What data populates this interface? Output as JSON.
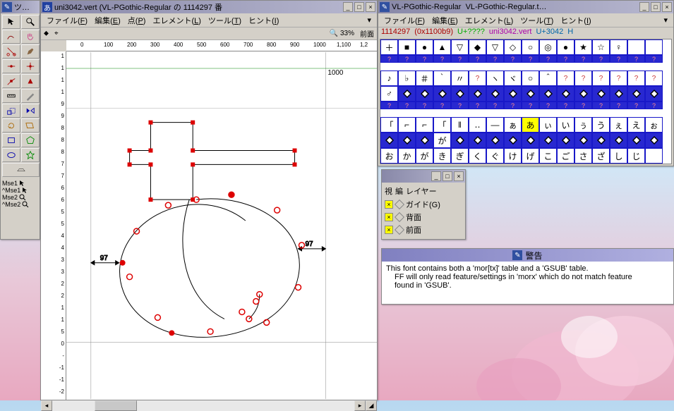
{
  "tool_window": {
    "title": "ツ…"
  },
  "glyph_window": {
    "icon": "あ",
    "title": "uni3042.vert (VL-PGothic-Regular の 1114297 番",
    "menus": [
      "ファイル(F)",
      "編集(E)",
      "点(P)",
      "エレメント(L)",
      "ツール(T)",
      "ヒント(I)"
    ],
    "info": {
      "zoom": "33%",
      "layer": "前面"
    },
    "ruler_h": [
      "0",
      "100",
      "200",
      "300",
      "400",
      "500",
      "600",
      "700",
      "800",
      "900",
      "1000",
      "1,100",
      "1,2"
    ],
    "ruler_v": [
      "1",
      "1",
      "1",
      "1",
      "9",
      "9",
      "8",
      "8",
      "8",
      "7",
      "7",
      "6",
      "6",
      "5",
      "5",
      "4",
      "4",
      "3",
      "3",
      "2",
      "2",
      "1",
      "1",
      "5",
      "0",
      "-",
      "-1",
      "-1",
      "-2"
    ],
    "adv_label_left": "97",
    "adv_label_right": "97",
    "em_label": "1000"
  },
  "font_window": {
    "title_left": "VL-PGothic-Regular",
    "title_right": "VL-PGothic-Regular.t…",
    "menus": [
      "ファイル(F)",
      "編集(E)",
      "エレメント(L)",
      "ツール(T)",
      "ヒント(I)"
    ],
    "info": {
      "cid": "1114297",
      "hex": "(0x1100b9)",
      "uq": "U+????",
      "name": "uni3042.vert",
      "u": "U+3042",
      "rest": "H"
    },
    "rows": [
      [
        "＋",
        "■",
        "●",
        "▲",
        "▽",
        "◆",
        "▽",
        "◇",
        "○",
        "◎",
        "●",
        "★",
        "☆",
        "♀"
      ],
      [
        "?",
        "?",
        "?",
        "?",
        "?",
        "?",
        "?",
        "?",
        "?",
        "?",
        "?",
        "?",
        "?",
        "?",
        "?",
        "?"
      ],
      [
        "♪",
        "♭",
        "＃",
        "｀",
        "〃",
        "?",
        "ヽ",
        "ヾ",
        "○",
        "＾",
        "?",
        "?",
        "?",
        "?",
        "?",
        "?"
      ],
      [
        "♂",
        "◈",
        "◈",
        "◈",
        "◈",
        "◈",
        "◈",
        "◈",
        "◈",
        "◈",
        "◈",
        "◈",
        "◈",
        "◈",
        "◈",
        "◈"
      ],
      [
        "?",
        "?",
        "?",
        "?",
        "?",
        "?",
        "?",
        "?",
        "?",
        "?",
        "?",
        "?",
        "?",
        "?",
        "?",
        "?"
      ],
      [
        "「",
        "⌐",
        "⌐",
        "「",
        "‖",
        "‥",
        "―",
        "ぁ",
        "あ",
        "ぃ",
        "い",
        "ぅ",
        "う",
        "ぇ",
        "え",
        "ぉ"
      ],
      [
        "◈",
        "◈",
        "◈",
        "が",
        "◈",
        "◈",
        "◈",
        "◈",
        "◈",
        "◈",
        "◈",
        "◈",
        "◈",
        "◈",
        "◈",
        "◈"
      ],
      [
        "お",
        "か",
        "が",
        "き",
        "ぎ",
        "く",
        "ぐ",
        "け",
        "げ",
        "こ",
        "ご",
        "さ",
        "ざ",
        "し",
        "じ"
      ]
    ],
    "selected": [
      5,
      8
    ]
  },
  "layers_window": {
    "hdr": [
      "視",
      "編",
      "レイヤー"
    ],
    "rows": [
      {
        "chk1": true,
        "chk2": false,
        "label": "ガイド(G)"
      },
      {
        "chk1": true,
        "chk2": false,
        "label": "背面"
      },
      {
        "chk1": true,
        "chk2": false,
        "label": "前面"
      }
    ]
  },
  "warn_window": {
    "title": "警告",
    "line1": "This font contains both a 'mor[tx]' table and a 'GSUB' table.",
    "line2": "FF will only read feature/settings in 'morx' which do not match feature",
    "line3": "found in 'GSUB'."
  }
}
